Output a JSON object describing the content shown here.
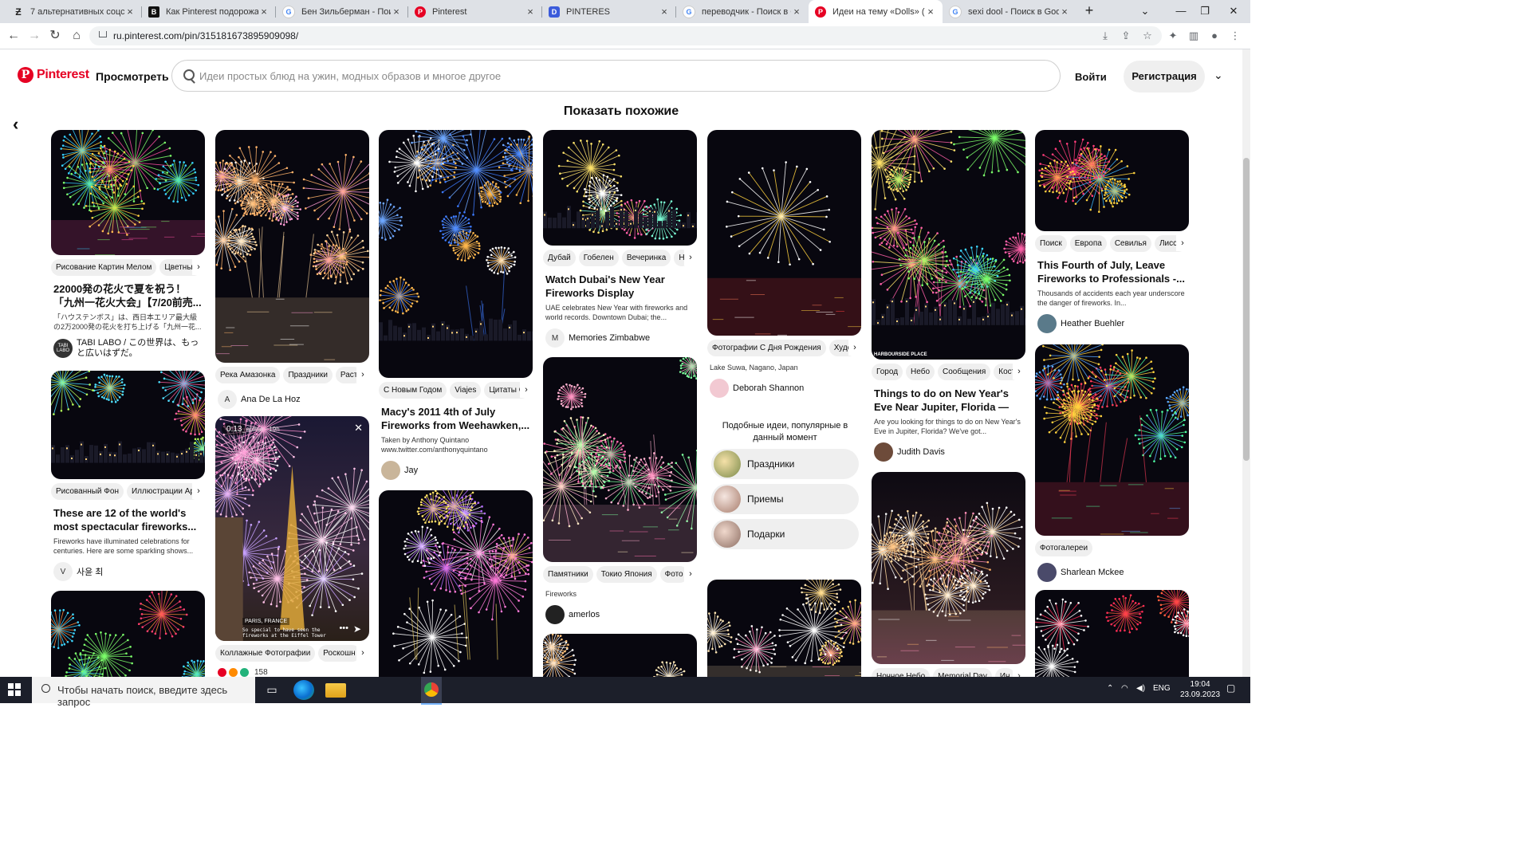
{
  "browser": {
    "tabs": [
      {
        "label": "7 альтернативных соцсетей",
        "icon": "z-icon",
        "active": false
      },
      {
        "label": "Как Pinterest подорожал",
        "icon": "bold-b-icon",
        "active": false
      },
      {
        "label": "Бен Зильберман - Поиск",
        "icon": "google-icon",
        "active": false
      },
      {
        "label": "Pinterest",
        "icon": "pinterest-icon",
        "active": false
      },
      {
        "label": "PINTERES",
        "icon": "d-icon",
        "active": false
      },
      {
        "label": "переводчик - Поиск в Go",
        "icon": "google-icon",
        "active": false
      },
      {
        "label": "Идеи на тему «Dolls» (81)",
        "icon": "pinterest-icon",
        "active": true
      },
      {
        "label": "sexi dool - Поиск в Google",
        "icon": "google-icon",
        "active": false
      }
    ],
    "new_tab": "+",
    "url": "ru.pinterest.com/pin/315181673895909098/",
    "buttons": {
      "back": "←",
      "forward": "→",
      "reload": "↻",
      "home": "⌂",
      "minimize": "—",
      "maximize": "❐",
      "close": "✕",
      "tabsearch": "⌄"
    }
  },
  "header": {
    "logo_text": "Pinterest",
    "explore": "Просмотреть",
    "search_placeholder": "Идеи простых блюд на ужин, модных образов и многое другое",
    "login": "Войти",
    "signup": "Регистрация"
  },
  "main": {
    "heading": "Показать похожие",
    "popular": {
      "heading": "Подобные идеи, популярные в данный момент",
      "items": [
        "Праздники",
        "Приемы",
        "Подарки"
      ]
    },
    "pins": [
      {
        "tags": [
          "Рисование Картин Мелом",
          "Цветные"
        ],
        "title": "22000発の花火で夏を祝う！「九州一花火大会」【7/20前売...",
        "desc": "「ハウステンボス」は、西日本エリア最大級の2万2000発の花火を打ち上げる「九州一花...",
        "author": "TABI LABO / この世界は、もっと広いはずだ。",
        "avatar": "TABI LABO"
      },
      {
        "tags": [
          "Рисованный Фон",
          "Иллюстрации Ар"
        ],
        "title": "These are 12 of the world's most spectacular fireworks...",
        "desc": "Fireworks have illuminated celebrations for centuries. Here are some sparkling shows...",
        "author": "사윤 최",
        "avatar": "V"
      },
      {
        "tags": []
      },
      {
        "tags": [
          "Река Амазонка",
          "Праздники",
          "Раст"
        ],
        "author": "Ana De La Hoz",
        "avatar": "A"
      },
      {
        "tags": [
          "Коллажные Фотографии",
          "Роскошн"
        ],
        "video_time": "0:13",
        "overlay_user": "_ephsa · 19h",
        "overlay_place": "PARIS, FRANCE",
        "overlay_caption": "So special to have seen the fireworks at the Eiffel Tower",
        "reacts": "158"
      },
      {
        "tags": [
          "С Новым Годом",
          "Viajes",
          "Цитаты С"
        ],
        "title": "Macy's 2011 4th of July Fireworks from Weehawken,...",
        "desc": "Taken by Anthony Quintano www.twitter.com/anthonyquintano",
        "author": "Jay",
        "avatar": ""
      },
      {
        "tags": []
      },
      {
        "tags": [
          "Дубай",
          "Гобелен",
          "Вечеринка",
          "Н"
        ],
        "title": "Watch Dubai's New Year Fireworks Display",
        "desc": "UAE celebrates New Year with fireworks and world records. Downtown Dubai; the...",
        "author": "Memories Zimbabwe",
        "avatar": "M"
      },
      {
        "tags": [
          "Памятники",
          "Токио Япония",
          "Фото"
        ],
        "desc": "Fireworks",
        "author": "amerlos",
        "avatar": ""
      },
      {
        "tags": []
      },
      {
        "tags": [
          "Фотографии С Дня Рождения",
          "Худо"
        ],
        "desc": "Lake Suwa, Nagano, Japan",
        "author": "Deborah Shannon",
        "avatar": ""
      },
      {
        "tags": []
      },
      {
        "tags": [
          "Город",
          "Небо",
          "Сообщения",
          "Кост"
        ],
        "title": "Things to do on New Year's Eve Near Jupiter, Florida — Meye...",
        "desc": "Are you looking for things to do on New Year's Eve in Jupiter, Florida? We've got...",
        "author": "Judith Davis",
        "avatar": "",
        "watermark": "HARBOURSIDE PLACE"
      },
      {
        "tags": [
          "Ночное Небо",
          "Memorial Day",
          "Ин"
        ]
      },
      {
        "tags": [
          "Поиск",
          "Европа",
          "Севилья",
          "Лиссо"
        ],
        "title": "This Fourth of July, Leave Fireworks to Professionals -...",
        "desc": "Thousands of accidents each year underscore the danger of fireworks. In...",
        "author": "Heather Buehler",
        "avatar": ""
      },
      {
        "tags": [
          "Фотогалереи"
        ],
        "author": "Sharlean Mckee",
        "avatar": ""
      },
      {
        "tags": []
      }
    ]
  },
  "taskbar": {
    "search_placeholder": "Чтобы начать поиск, введите здесь запрос",
    "lang": "ENG",
    "time": "19:04",
    "date": "23.09.2023"
  },
  "colors": {
    "pinterest_red": "#e60023",
    "tabbar": "#dee1e6",
    "taskbar": "#1c1f2a"
  }
}
